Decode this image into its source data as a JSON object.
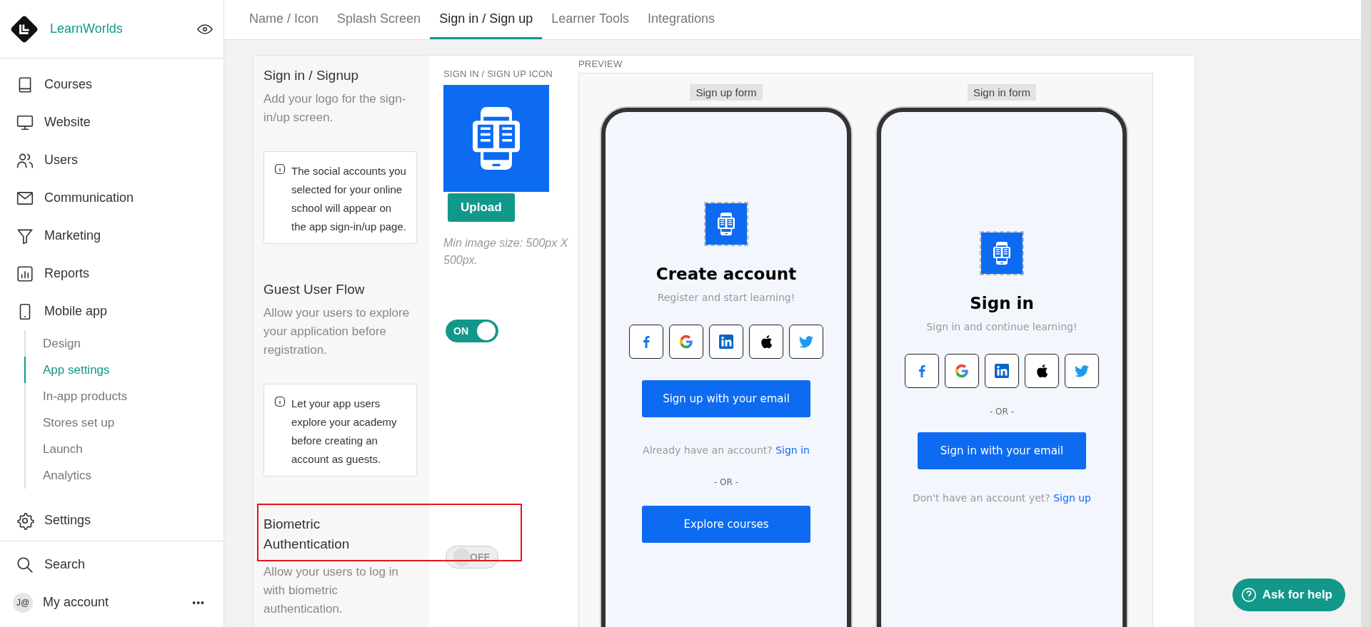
{
  "sidebar": {
    "brand": "LearnWorlds",
    "items": [
      {
        "label": "Courses",
        "selected": false
      },
      {
        "label": "Website",
        "selected": false
      },
      {
        "label": "Users",
        "selected": false
      },
      {
        "label": "Communication",
        "selected": false
      },
      {
        "label": "Marketing",
        "selected": false
      },
      {
        "label": "Reports",
        "selected": false
      },
      {
        "label": "Mobile app",
        "selected": false,
        "children": [
          {
            "label": "Design",
            "selected": false
          },
          {
            "label": "App settings",
            "selected": true
          },
          {
            "label": "In-app products",
            "selected": false
          },
          {
            "label": "Stores set up",
            "selected": false
          },
          {
            "label": "Launch",
            "selected": false
          },
          {
            "label": "Analytics",
            "selected": false
          }
        ]
      },
      {
        "label": "Settings",
        "selected": false
      }
    ],
    "search": "Search",
    "account": {
      "initials": "J@",
      "label": "My account",
      "menu": "•••"
    }
  },
  "tabs": [
    {
      "label": "Name / Icon",
      "selected": false
    },
    {
      "label": "Splash Screen",
      "selected": false
    },
    {
      "label": "Sign in / Sign up",
      "selected": true
    },
    {
      "label": "Learner Tools",
      "selected": false
    },
    {
      "label": "Integrations",
      "selected": false
    }
  ],
  "sections": [
    {
      "kind": "upload",
      "title": "Sign in / Signup",
      "description": "Add your logo for the sign-in/up screen.",
      "note": "The social accounts you selected for your online school will appear on the app sign-in/up page.",
      "field_label": "SIGN IN / SIGN UP ICON",
      "button": "Upload",
      "hint": "Min image size: 500px X 500px.",
      "highlighted": false
    },
    {
      "kind": "toggle",
      "title": "Guest User Flow",
      "description": "Allow your users to explore your application before registration.",
      "note": "Let your app users explore your academy before creating an account as guests.",
      "toggle": {
        "on": true,
        "label": "ON"
      },
      "highlighted": false
    },
    {
      "kind": "toggle",
      "title": "Biometric Authentication",
      "description": "Allow your users to log in with biometric authentication.",
      "toggle": {
        "on": false,
        "label": "OFF"
      },
      "highlighted": true
    }
  ],
  "preview": {
    "label": "PREVIEW",
    "forms": [
      {
        "tag": "Sign up form",
        "title": "Create account",
        "subtitle": "Register and start learning!",
        "blocks": [
          {
            "kind": "socials"
          },
          {
            "kind": "button",
            "label": "Sign up with your email"
          },
          {
            "kind": "prompt",
            "text": "Already have an account?",
            "link": "Sign in"
          },
          {
            "kind": "divider",
            "label": "- OR -"
          },
          {
            "kind": "button",
            "label": "Explore courses"
          }
        ]
      },
      {
        "tag": "Sign in form",
        "title": "Sign in",
        "subtitle": "Sign in and continue learning!",
        "blocks": [
          {
            "kind": "socials"
          },
          {
            "kind": "divider",
            "label": "- OR -"
          },
          {
            "kind": "button",
            "label": "Sign in with your email"
          },
          {
            "kind": "prompt",
            "text": "Don't have an account yet?",
            "link": "Sign up"
          }
        ]
      }
    ]
  },
  "help": {
    "label": "Ask for help"
  }
}
